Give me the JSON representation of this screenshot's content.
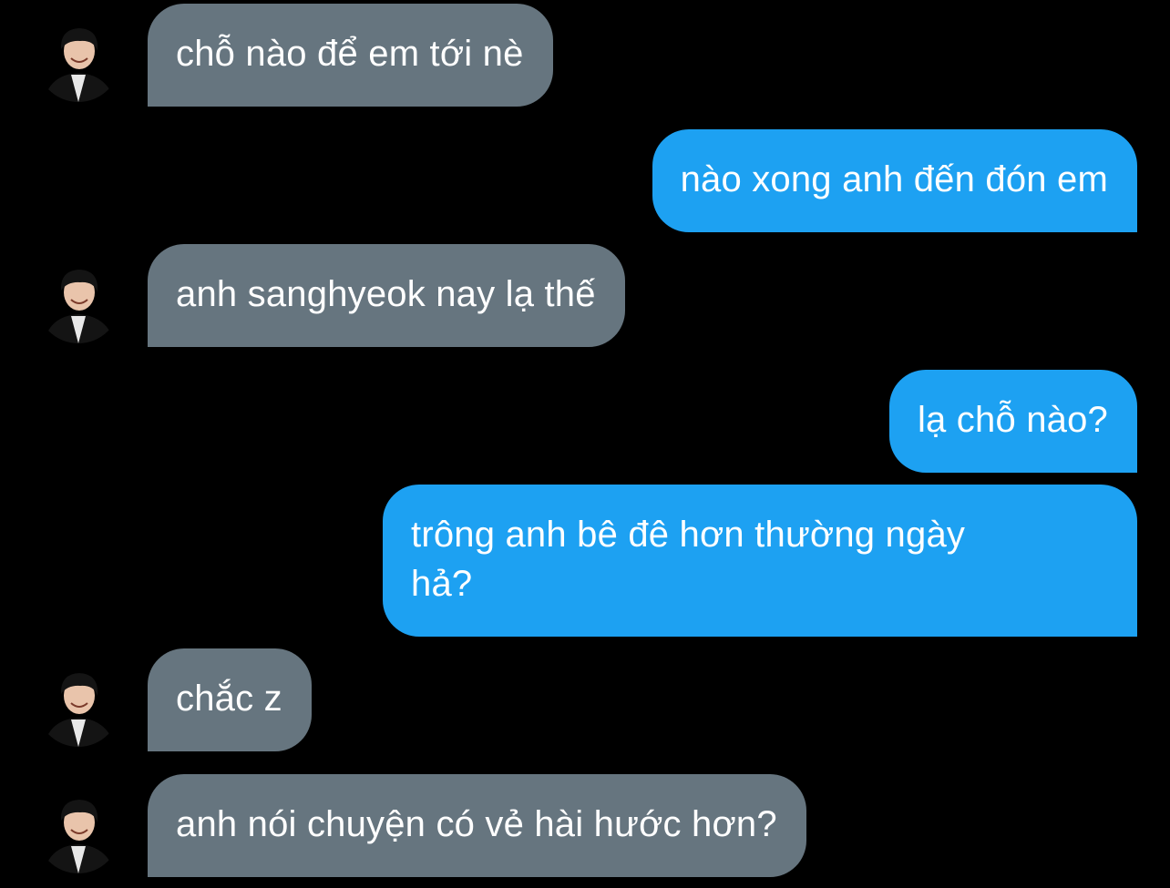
{
  "colors": {
    "background": "#000000",
    "incoming_bubble": "#66757f",
    "outgoing_bubble": "#1da1f2",
    "text": "#ffffff"
  },
  "messages": [
    {
      "direction": "incoming",
      "text": "chỗ nào để em tới nè",
      "avatar": "contact-avatar"
    },
    {
      "direction": "outgoing",
      "text": "nào xong anh đến đón em"
    },
    {
      "direction": "incoming",
      "text": "anh sanghyeok nay lạ thế",
      "avatar": "contact-avatar"
    },
    {
      "direction": "outgoing",
      "text": "lạ chỗ nào?"
    },
    {
      "direction": "outgoing",
      "text": "trông anh bê đê hơn thường ngày\nhả?"
    },
    {
      "direction": "incoming",
      "text": "chắc z",
      "avatar": "contact-avatar"
    },
    {
      "direction": "incoming",
      "text": "anh nói chuyện có vẻ hài hước hơn?",
      "avatar": "contact-avatar"
    }
  ]
}
